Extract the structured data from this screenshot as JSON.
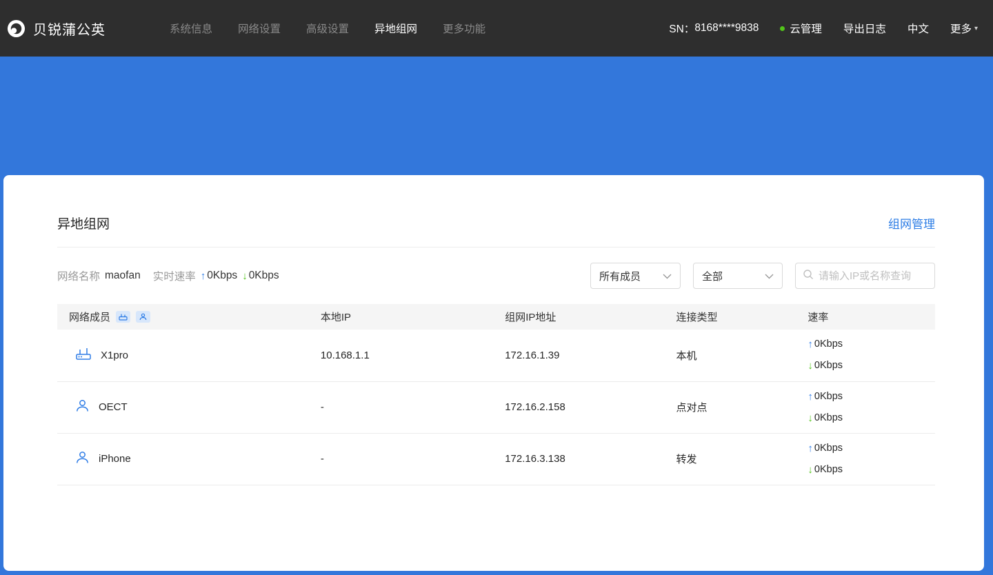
{
  "navbar": {
    "brand": "贝锐蒲公英",
    "items": [
      {
        "label": "系统信息",
        "active": false
      },
      {
        "label": "网络设置",
        "active": false
      },
      {
        "label": "高级设置",
        "active": false
      },
      {
        "label": "异地组网",
        "active": true
      },
      {
        "label": "更多功能",
        "active": false
      }
    ],
    "sn_label": "SN：",
    "sn_value": "8168****9838",
    "cloud_label": "云管理",
    "export_log": "导出日志",
    "language": "中文",
    "more": "更多"
  },
  "panel": {
    "title": "异地组网",
    "manage_link": "组网管理",
    "network_name_label": "网络名称",
    "network_name": "maofan",
    "speed_label": "实时速率",
    "up_speed": "0Kbps",
    "down_speed": "0Kbps",
    "filters": {
      "member_filter": "所有成员",
      "type_filter": "全部",
      "search_placeholder": "请输入IP或名称查询"
    },
    "table": {
      "headers": [
        "网络成员",
        "本地IP",
        "组网IP地址",
        "连接类型",
        "速率"
      ],
      "rows": [
        {
          "name": "X1pro",
          "device": "router",
          "local_ip": "10.168.1.1",
          "vpn_ip": "172.16.1.39",
          "conn_type": "本机",
          "up": "0Kbps",
          "down": "0Kbps"
        },
        {
          "name": "OECT",
          "device": "user",
          "local_ip": "-",
          "vpn_ip": "172.16.2.158",
          "conn_type": "点对点",
          "up": "0Kbps",
          "down": "0Kbps"
        },
        {
          "name": "iPhone",
          "device": "user",
          "local_ip": "-",
          "vpn_ip": "172.16.3.138",
          "conn_type": "转发",
          "up": "0Kbps",
          "down": "0Kbps"
        }
      ]
    }
  },
  "icons": {
    "up_arrow": "↑",
    "down_arrow": "↓",
    "more_caret": "▾"
  },
  "colors": {
    "accent_blue": "#2E7CE6",
    "link_blue": "#2B7CE5",
    "status_green": "#52C41A",
    "navbar_bg": "#2E2E2E",
    "banner_blue": "#3377DB"
  }
}
